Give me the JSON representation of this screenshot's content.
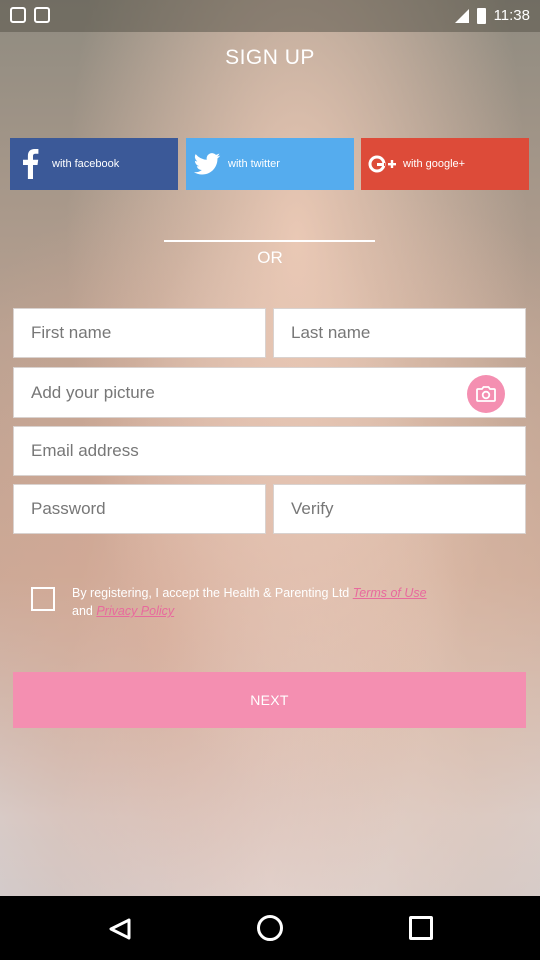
{
  "status_bar": {
    "time": "11:38"
  },
  "header": {
    "title": "SIGN UP"
  },
  "social": {
    "facebook": {
      "label": "with facebook",
      "color": "#3b5998",
      "icon": "facebook-icon"
    },
    "twitter": {
      "label": "with twitter",
      "color": "#55acee",
      "icon": "twitter-icon"
    },
    "google": {
      "label": "with google+",
      "color": "#dd4b39",
      "icon": "google-plus-icon"
    }
  },
  "divider": {
    "text": "OR"
  },
  "form": {
    "first_name": {
      "placeholder": "First name"
    },
    "last_name": {
      "placeholder": "Last name"
    },
    "picture": {
      "placeholder": "Add your picture",
      "icon": "camera-icon"
    },
    "email": {
      "placeholder": "Email address"
    },
    "password": {
      "placeholder": "Password"
    },
    "verify": {
      "placeholder": "Verify"
    }
  },
  "terms": {
    "checked": false,
    "text_prefix": "By registering, I accept the Health & Parenting Ltd ",
    "terms_link": "Terms of Use",
    "and_text": " and ",
    "privacy_link": "Privacy Policy"
  },
  "next_button": {
    "label": "NEXT",
    "color": "#f48fb1"
  },
  "accent_color": "#e86a9d"
}
